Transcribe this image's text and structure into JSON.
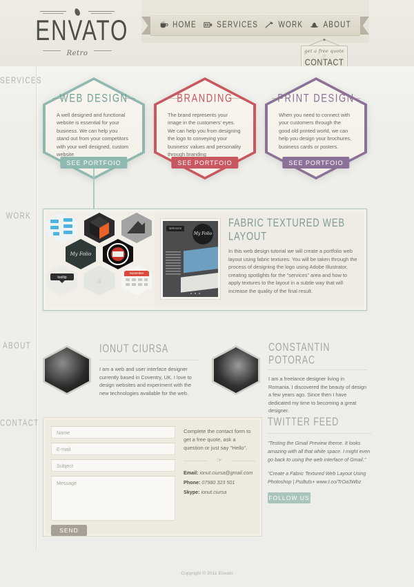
{
  "brand": {
    "name": "ENVATO",
    "tagline": "Retro",
    "bean_icon": "coffee-bean-icon"
  },
  "nav": {
    "items": [
      {
        "label": "HOME",
        "icon": "coffee-cup-icon"
      },
      {
        "label": "SERVICES",
        "icon": "projector-icon"
      },
      {
        "label": "WORK",
        "icon": "axe-icon"
      },
      {
        "label": "ABOUT",
        "icon": "hat-icon"
      }
    ]
  },
  "contact_tag": {
    "quote": "get a free quote",
    "hand_icon": "pointing-hand-icon",
    "cta": "CONTACT US"
  },
  "sidebar": {
    "items": [
      {
        "label": "SERVICES"
      },
      {
        "label": "WORK"
      },
      {
        "label": "ABOUT"
      },
      {
        "label": "CONTACT"
      }
    ]
  },
  "services": {
    "cards": [
      {
        "title": "WEB DESIGN",
        "body": "A well designed and functional website is essential for your business. We can help you stand out from your competitors with your well designed, custom website",
        "button": "SEE PORTFOIO",
        "color": "#8fb8b0",
        "border": "#8fb8b0"
      },
      {
        "title": "BRANDING",
        "body": "The brand represents your image in the customers' eyes. We can help you from designing the logo to conveying your business' values and personality through branding",
        "button": "SEE PORTFOIO",
        "color": "#c8575f",
        "border": "#c8575f"
      },
      {
        "title": "PRINT DESIGN",
        "body": "When you need to connect with your customers through the good old printed world, we can help you design your brochures, business cards or posters.",
        "button": "SEE PORTFOIO",
        "color": "#8b7197",
        "border": "#8b7197"
      }
    ]
  },
  "work": {
    "thumbnails": [
      {
        "name": "flowchart-thumbnail",
        "label": "",
        "bg": "#f1f3f2"
      },
      {
        "name": "orange-cube-thumbnail",
        "label": "",
        "bg": "#2d2d2d"
      },
      {
        "name": "grey-hand-thumbnail",
        "label": "",
        "bg": "#a8a8a8"
      },
      {
        "name": "myfolio-thumbnail",
        "label": "My Folio",
        "bg": "#2f3a38"
      },
      {
        "name": "dark-badge-thumbnail",
        "label": "",
        "bg": "#121212"
      },
      {
        "name": "tooltip-thumbnail",
        "label": "tooltip",
        "bg": "#e9e9e6"
      },
      {
        "name": "letter-a-thumbnail",
        "label": "a",
        "bg": "#e4e6e1"
      },
      {
        "name": "calendar-thumbnail",
        "label": "November",
        "bg": "#d94a3d"
      }
    ],
    "featured": {
      "title": "FABRIC TEXTURED WEB LAYOUT",
      "body": "In this web design tutorial we will create a portfolio web layout using fabric textures. You will be taken through the process of designing the logo using Adobe Illustrator, creating spotlights for the \"services\" area and how to apply textures to the layout in a subtle way that will increase the quality of the final result.",
      "preview_label": "SERVICES",
      "preview_logo": "My Folio"
    }
  },
  "about": {
    "people": [
      {
        "name": "IONUT CIURSA",
        "bio": "I am a web and user interface designer currently based in Coventry, UK. I love to design websites and experiment with the new technologies available for the web."
      },
      {
        "name": "CONSTANTIN POTORAC",
        "bio": "I am a freelance designer living in Romania. I discovered the beauty of design a few years ago. Since then I have dedicated my time to becoming a great designer."
      }
    ]
  },
  "contact": {
    "fields": [
      {
        "name": "name-field",
        "placeholder": "Name"
      },
      {
        "name": "email-field",
        "placeholder": "E-mail"
      },
      {
        "name": "subject-field",
        "placeholder": "Subject"
      },
      {
        "name": "message-field",
        "placeholder": "Message"
      }
    ],
    "send_label": "SEND",
    "lead": "Complete the contact form to get a free quote, ask a question or just say \"Hello\".",
    "hand_icon": "pointing-hand-icon",
    "details": [
      {
        "label": "Email:",
        "value": "ionut.ciursa@gmail.com"
      },
      {
        "label": "Phone:",
        "value": "07980 323 501"
      },
      {
        "label": "Skype:",
        "value": "ionut.ciursa"
      }
    ]
  },
  "twitter": {
    "title": "TWITTER FEED",
    "tweets": [
      "\"Testing the Gmail Preview theme. It looks amazing with all that white space. I might even go back to using the web interface of Gmail.\"",
      "\"Create a Fabric Textured Web Layout Using Photoshop | Psdtuts+ www.t.co/TrOa3Wbz"
    ],
    "follow_label": "FOLLOW US",
    "accent": "#a9c5bc"
  },
  "footer": {
    "copyright": "Copyright © 2011 Envato"
  }
}
